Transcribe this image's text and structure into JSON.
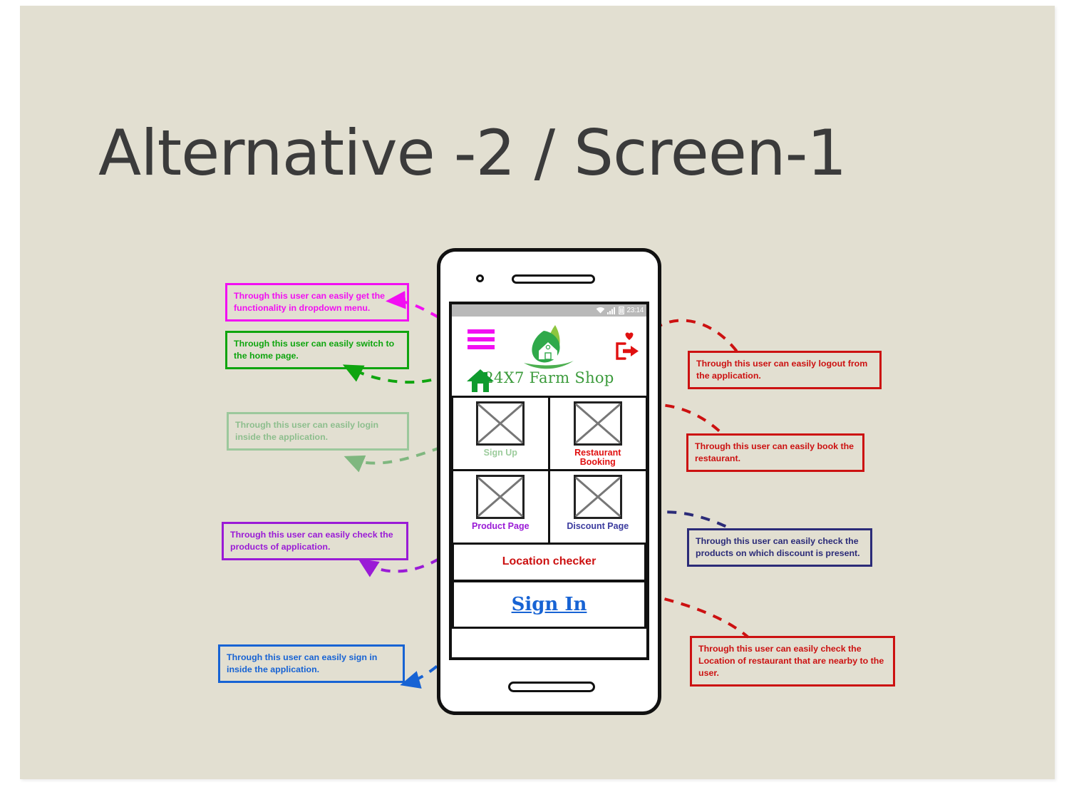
{
  "slide": {
    "title": "Alternative -2 / Screen-1",
    "background_color": "#E2DFD1"
  },
  "phone": {
    "status_bar": {
      "time": "23:14",
      "icons": [
        "wifi-icon",
        "signal-icon",
        "battery-icon"
      ]
    },
    "header": {
      "menu_icon": "hamburger-menu-icon",
      "home_icon": "home-icon",
      "logout_icon": "logout-icon",
      "logo_icon": "leaf-house-logo-icon",
      "brand": "24X7 Farm Shop",
      "brand_color": "#3C9B3C"
    },
    "tiles": [
      {
        "label": "Sign Up",
        "color": "#9CCC9C",
        "placeholder": "image-placeholder"
      },
      {
        "label": "Restaurant\nBooking",
        "line1": "Restaurant",
        "line2": "Booking",
        "color": "#E01010",
        "placeholder": "image-placeholder"
      },
      {
        "label": "Product Page",
        "color": "#9A1BD6",
        "placeholder": "image-placeholder"
      },
      {
        "label": "Discount Page",
        "color": "#3B3B9E",
        "placeholder": "image-placeholder"
      }
    ],
    "location_button": {
      "label": "Location checker",
      "color": "#CC1111"
    },
    "signin_button": {
      "label": "Sign In",
      "color": "#1763D4"
    }
  },
  "annotations": [
    {
      "id": "dropdown",
      "text": "Through this user can easily get the functionality in dropdown menu.",
      "color": "#F20FF2"
    },
    {
      "id": "home",
      "text": "Through this user can easily switch to the home page.",
      "color": "#0FA50F"
    },
    {
      "id": "login",
      "text": "Through this user can easily login inside the application.",
      "color": "#8DBE8D"
    },
    {
      "id": "products",
      "text": "Through this user can easily check the products of application.",
      "color": "#9A1BD6"
    },
    {
      "id": "signin",
      "text": "Through this user can easily sign in inside the application.",
      "color": "#1763D4"
    },
    {
      "id": "logout",
      "text": "Through this user can easily logout from the application.",
      "color": "#CC1111"
    },
    {
      "id": "booking",
      "text": "Through this user can easily book the restaurant.",
      "color": "#CC1111"
    },
    {
      "id": "discount",
      "text": "Through this user can easily check the products on which discount is present.",
      "color": "#2B2B78"
    },
    {
      "id": "location",
      "text": "Through this user can easily check the Location of restaurant that are nearby to the user.",
      "color": "#CC1111"
    }
  ]
}
